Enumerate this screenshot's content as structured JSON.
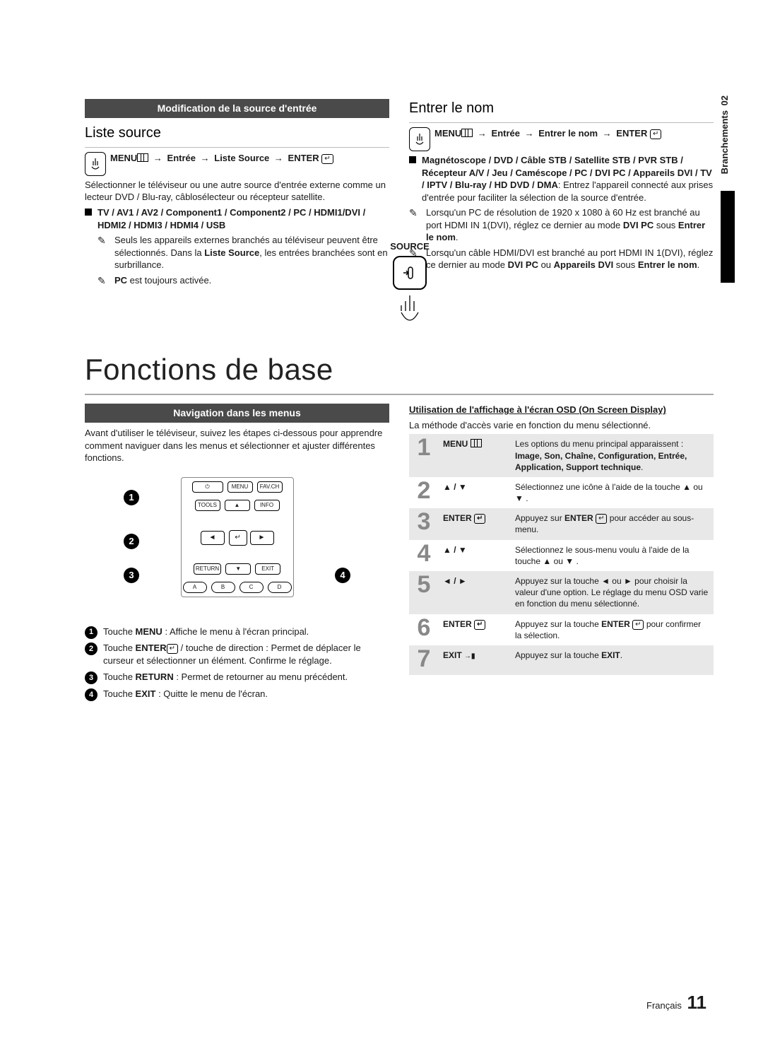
{
  "chapter": {
    "num": "02",
    "name": "Branchements"
  },
  "left": {
    "header": "Modification de la source d'entrée",
    "section_title": "Liste source",
    "menu_path": "MENU → Entrée → Liste Source → ENTER",
    "intro": "Sélectionner le téléviseur ou une autre source d'entrée externe comme un lecteur DVD / Blu-ray, câblosélecteur ou récepteur satellite.",
    "source_label": "SOURCE",
    "inputs_line": "TV / AV1 / AV2 / Component1 / Component2 / PC / HDMI1/DVI / HDMI2 / HDMI3 / HDMI4 / USB",
    "note1_pre": "Seuls les appareils externes branchés au téléviseur peuvent être sélectionnés. Dans la ",
    "note1_bold": "Liste Source",
    "note1_post": ", les entrées branchées sont en surbrillance.",
    "note2_pre": "",
    "note2_bold": "PC",
    "note2_post": " est toujours activée."
  },
  "right": {
    "section_title": "Entrer le nom",
    "menu_path": "MENU → Entrée → Entrer le nom → ENTER",
    "options_bold": "Magnétoscope / DVD / Câble STB / Satellite STB / PVR STB / Récepteur A/V / Jeu / Caméscope / PC / DVI PC / Appareils DVI / TV / IPTV / Blu-ray / HD DVD / DMA",
    "options_rest": ": Entrez l'appareil connecté aux prises d'entrée pour faciliter la sélection de la source d'entrée.",
    "note1": "Lorsqu'un PC de résolution de 1920 x 1080 à 60 Hz est branché au port HDMI IN 1(DVI), réglez ce dernier au mode DVI PC sous Entrer le nom.",
    "note1_bold1": "DVI PC",
    "note1_bold2": "Entrer le nom",
    "note2": "Lorsqu'un câble HDMI/DVI est branché au port HDMI IN 1(DVI), réglez ce dernier au mode DVI PC ou Appareils DVI sous Entrer le nom.",
    "note2_bold1": "DVI PC",
    "note2_bold2": "Appareils DVI",
    "note2_bold3": "Entrer le nom"
  },
  "big_heading": "Fonctions de base",
  "nav": {
    "header": "Navigation dans les menus",
    "intro": "Avant d'utiliser le téléviseur, suivez les étapes ci-dessous pour apprendre comment naviguer dans les menus et sélectionner et ajuster différentes fonctions.",
    "remote_labels": {
      "menu": "MENU",
      "favch": "FAV.CH",
      "tools": "TOOLS",
      "info": "INFO",
      "return": "RETURN",
      "exit": "EXIT",
      "a": "A",
      "b": "B",
      "c": "C",
      "d": "D",
      "enter_glyph": "↵"
    },
    "bullets": {
      "b1_pre": "Touche ",
      "b1_bold": "MENU",
      "b1_post": " : Affiche le menu à l'écran principal.",
      "b2_pre": "Touche ",
      "b2_bold": "ENTER",
      "b2_post": " / touche de direction : Permet de déplacer le curseur et sélectionner un élément. Confirme le réglage.",
      "b3_pre": "Touche ",
      "b3_bold": "RETURN",
      "b3_post": " : Permet de retourner au menu précédent.",
      "b4_pre": "Touche ",
      "b4_bold": "EXIT",
      "b4_post": " : Quitte le menu de l'écran."
    },
    "callouts": {
      "c1": "1",
      "c2": "2",
      "c3": "3",
      "c4": "4"
    }
  },
  "osd": {
    "title": "Utilisation de l'affichage à l'écran OSD (On Screen Display)",
    "subtitle": "La méthode d'accès varie en fonction du menu sélectionné.",
    "rows": [
      {
        "num": "1",
        "key": "MENU",
        "desc_pre": "Les options du menu principal apparaissent :",
        "desc_bold": "Image, Son, Chaîne, Configuration, Entrée, Application, Support technique",
        "desc_post": "."
      },
      {
        "num": "2",
        "key": "▲ / ▼",
        "desc": "Sélectionnez une icône à l'aide de la touche ▲ ou ▼ ."
      },
      {
        "num": "3",
        "key": "ENTER",
        "desc": "Appuyez sur ENTER pour accéder au sous-menu."
      },
      {
        "num": "4",
        "key": "▲ / ▼",
        "desc": "Sélectionnez le sous-menu voulu à l'aide de la touche ▲ ou ▼ ."
      },
      {
        "num": "5",
        "key": "◄ / ►",
        "desc": "Appuyez sur la touche ◄ ou ► pour choisir la valeur d'une option. Le réglage du menu OSD varie en fonction du menu sélectionné."
      },
      {
        "num": "6",
        "key": "ENTER",
        "desc": "Appuyez sur la touche ENTER pour confirmer la sélection."
      },
      {
        "num": "7",
        "key": "EXIT",
        "desc": "Appuyez sur la touche EXIT."
      }
    ]
  },
  "footer": {
    "lang": "Français",
    "page": "11"
  }
}
